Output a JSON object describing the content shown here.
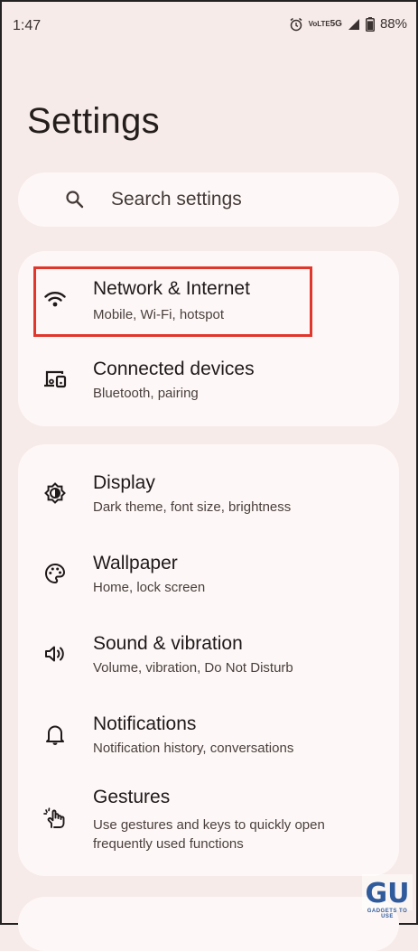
{
  "status_bar": {
    "time": "1:47",
    "volte_label": "VoLTE",
    "network_label": "5G",
    "battery_text": "88%",
    "battery_level": 0.88
  },
  "page": {
    "title": "Settings"
  },
  "search": {
    "placeholder": "Search settings"
  },
  "groups": [
    {
      "items": [
        {
          "title": "Network & Internet",
          "subtitle": "Mobile, Wi-Fi, hotspot",
          "icon": "wifi-icon"
        },
        {
          "title": "Connected devices",
          "subtitle": "Bluetooth, pairing",
          "icon": "devices-icon"
        }
      ]
    },
    {
      "items": [
        {
          "title": "Display",
          "subtitle": "Dark theme, font size, brightness",
          "icon": "brightness-icon"
        },
        {
          "title": "Wallpaper",
          "subtitle": "Home, lock screen",
          "icon": "palette-icon"
        },
        {
          "title": "Sound & vibration",
          "subtitle": "Volume, vibration, Do Not Disturb",
          "icon": "volume-icon"
        },
        {
          "title": "Notifications",
          "subtitle": "Notification history, conversations",
          "icon": "bell-icon"
        },
        {
          "title": "Gestures",
          "subtitle": "Use gestures and keys to quickly open frequently used functions",
          "icon": "gesture-icon"
        }
      ]
    }
  ],
  "highlight_color": "#e0362b",
  "watermark": {
    "logo_text": "GU",
    "text": "GADGETS TO USE"
  }
}
